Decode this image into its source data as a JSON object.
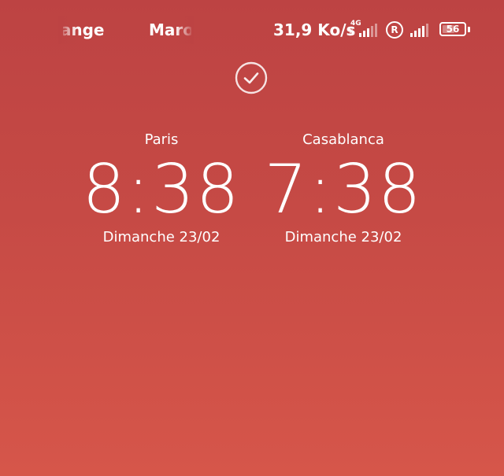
{
  "status_bar": {
    "carrier_1": "Orange",
    "carrier_2": "Maroc",
    "net_speed": "31,9 Ko/s",
    "network_type": "4G",
    "roaming": "R",
    "battery_level": "56",
    "battery_percent": 56,
    "icons": [
      "signal-icon",
      "roaming-icon",
      "signal-icon",
      "battery-icon"
    ]
  },
  "unlock": {
    "icon": "check-circle-icon"
  },
  "clocks": [
    {
      "city": "Paris",
      "time": "8:38",
      "date": "Dimanche 23/02"
    },
    {
      "city": "Casablanca",
      "time": "7:38",
      "date": "Dimanche 23/02"
    }
  ],
  "colors": {
    "background_top": "#bd4343",
    "background_bottom": "#d6564a",
    "text": "#ffffff"
  }
}
